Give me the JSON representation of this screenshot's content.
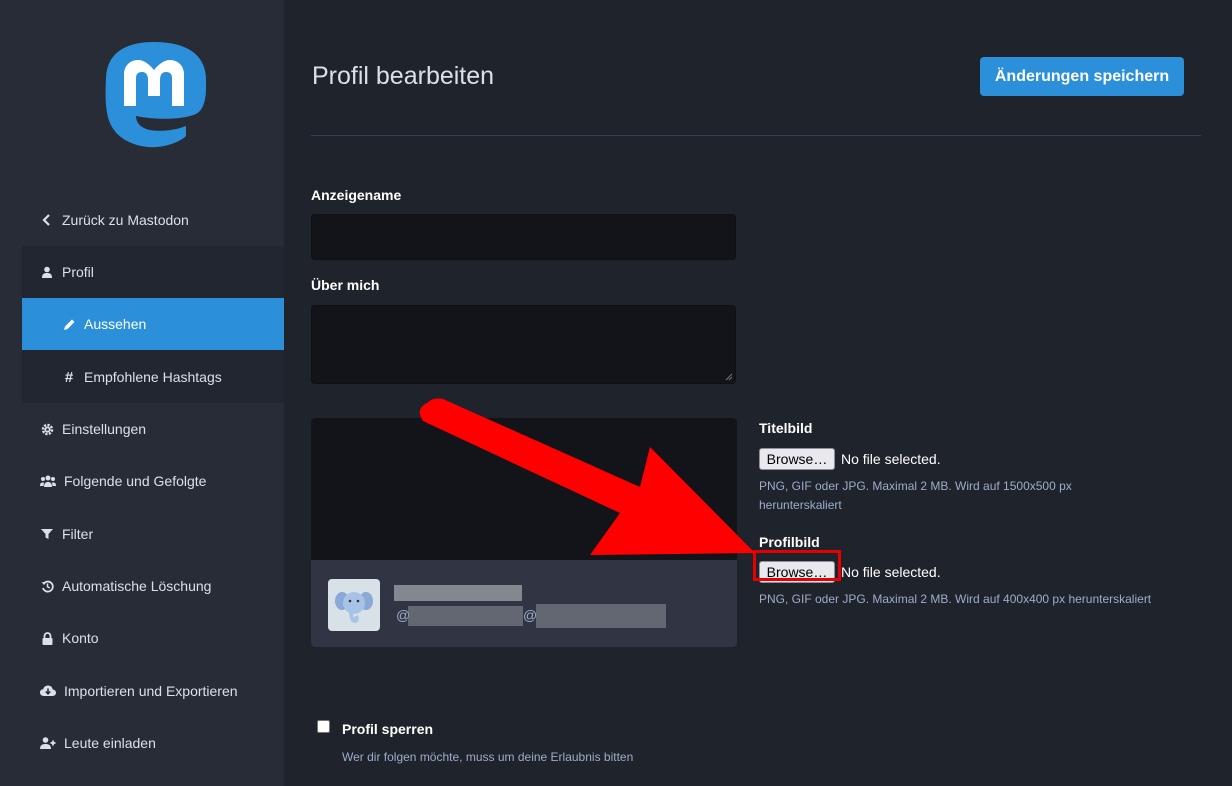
{
  "sidebar": {
    "items": [
      {
        "label": "Zurück zu Mastodon",
        "icon": "chevron-left-icon"
      },
      {
        "label": "Profil",
        "icon": "user-icon"
      },
      {
        "label": "Aussehen",
        "icon": "pencil-icon"
      },
      {
        "label": "Empfohlene Hashtags",
        "icon": "hashtag-icon"
      },
      {
        "label": "Einstellungen",
        "icon": "gear-icon"
      },
      {
        "label": "Folgende und Gefolgte",
        "icon": "users-icon"
      },
      {
        "label": "Filter",
        "icon": "filter-icon"
      },
      {
        "label": "Automatische Löschung",
        "icon": "history-icon"
      },
      {
        "label": "Konto",
        "icon": "lock-icon"
      },
      {
        "label": "Importieren und Exportieren",
        "icon": "cloud-download-icon"
      },
      {
        "label": "Leute einladen",
        "icon": "user-plus-icon"
      }
    ]
  },
  "header": {
    "title": "Profil bearbeiten",
    "save_label": "Änderungen speichern"
  },
  "form": {
    "display_name_label": "Anzeigename",
    "display_name_value": "",
    "bio_label": "Über mich",
    "bio_value": "",
    "header_image": {
      "label": "Titelbild",
      "button": "Browse…",
      "status": "No file selected.",
      "hint": "PNG, GIF oder JPG. Maximal 2 MB. Wird auf 1500x500 px herunterskaliert"
    },
    "avatar_image": {
      "label": "Profilbild",
      "button": "Browse…",
      "status": "No file selected.",
      "hint": "PNG, GIF oder JPG. Maximal 2 MB. Wird auf 400x400 px herunterskaliert"
    },
    "locked": {
      "label": "Profil sperren",
      "hint": "Wer dir folgen möchte, muss um deine Erlaubnis bitten",
      "checked": false
    }
  },
  "preview": {
    "at_symbol": "@",
    "separator": "@"
  },
  "colors": {
    "accent": "#2b90d9",
    "annotation": "#e60000"
  }
}
